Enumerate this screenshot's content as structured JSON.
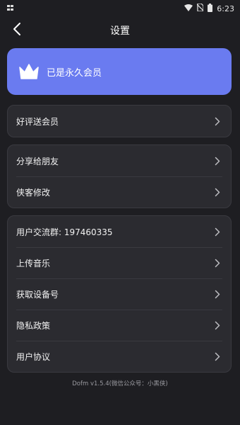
{
  "status_bar": {
    "time": "6:23",
    "left_icon": "notification-icon",
    "icons": [
      "wifi-icon",
      "no-sim-icon",
      "battery-icon"
    ]
  },
  "header": {
    "title": "设置",
    "back_icon": "chevron-left-icon"
  },
  "vip_card": {
    "label": "已是永久会员",
    "icon": "crown-icon",
    "color": "#6a7bf0"
  },
  "groups": [
    {
      "items": [
        {
          "label": "好评送会员"
        }
      ]
    },
    {
      "items": [
        {
          "label": "分享给朋友"
        },
        {
          "label": "侠客修改"
        }
      ]
    },
    {
      "items": [
        {
          "label": "用户交流群: 197460335"
        },
        {
          "label": "上传音乐"
        },
        {
          "label": "获取设备号"
        },
        {
          "label": "隐私政策"
        },
        {
          "label": "用户协议"
        }
      ]
    }
  ],
  "footer": {
    "version_text": "Dofm v1.5.4(微信公众号：小黑侠)"
  },
  "colors": {
    "background": "#1e1e22",
    "card": "#2b2b30",
    "accent": "#6a7bf0"
  }
}
